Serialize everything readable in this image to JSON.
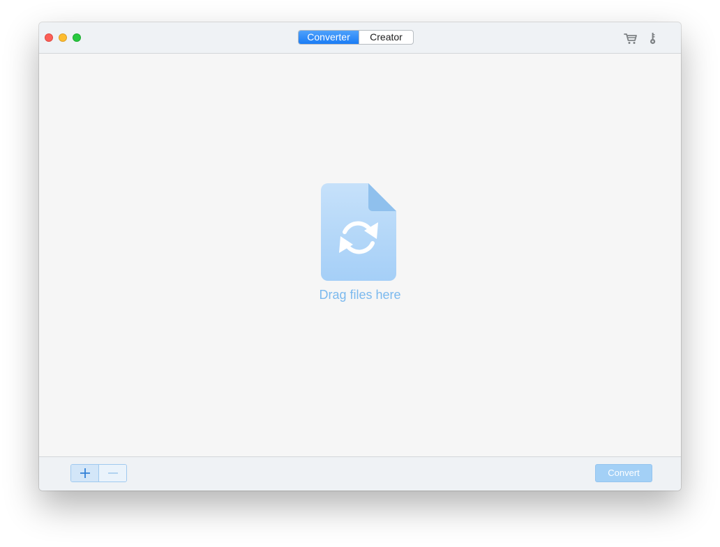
{
  "window": {
    "controls": [
      "close",
      "minimize",
      "maximize"
    ]
  },
  "titlebar": {
    "tabs": [
      {
        "label": "Converter",
        "selected": true
      },
      {
        "label": "Creator",
        "selected": false
      }
    ],
    "icons": [
      "cart-icon",
      "key-icon"
    ]
  },
  "dropzone": {
    "icon": "file-convert-icon",
    "label": "Drag files here"
  },
  "footer": {
    "add_icon": "plus-icon",
    "remove_icon": "minus-icon",
    "convert_label": "Convert"
  },
  "colors": {
    "accent": "#1a7cf5",
    "drop_label": "#7bb9ee",
    "convert_button": "#a3d0f6"
  }
}
